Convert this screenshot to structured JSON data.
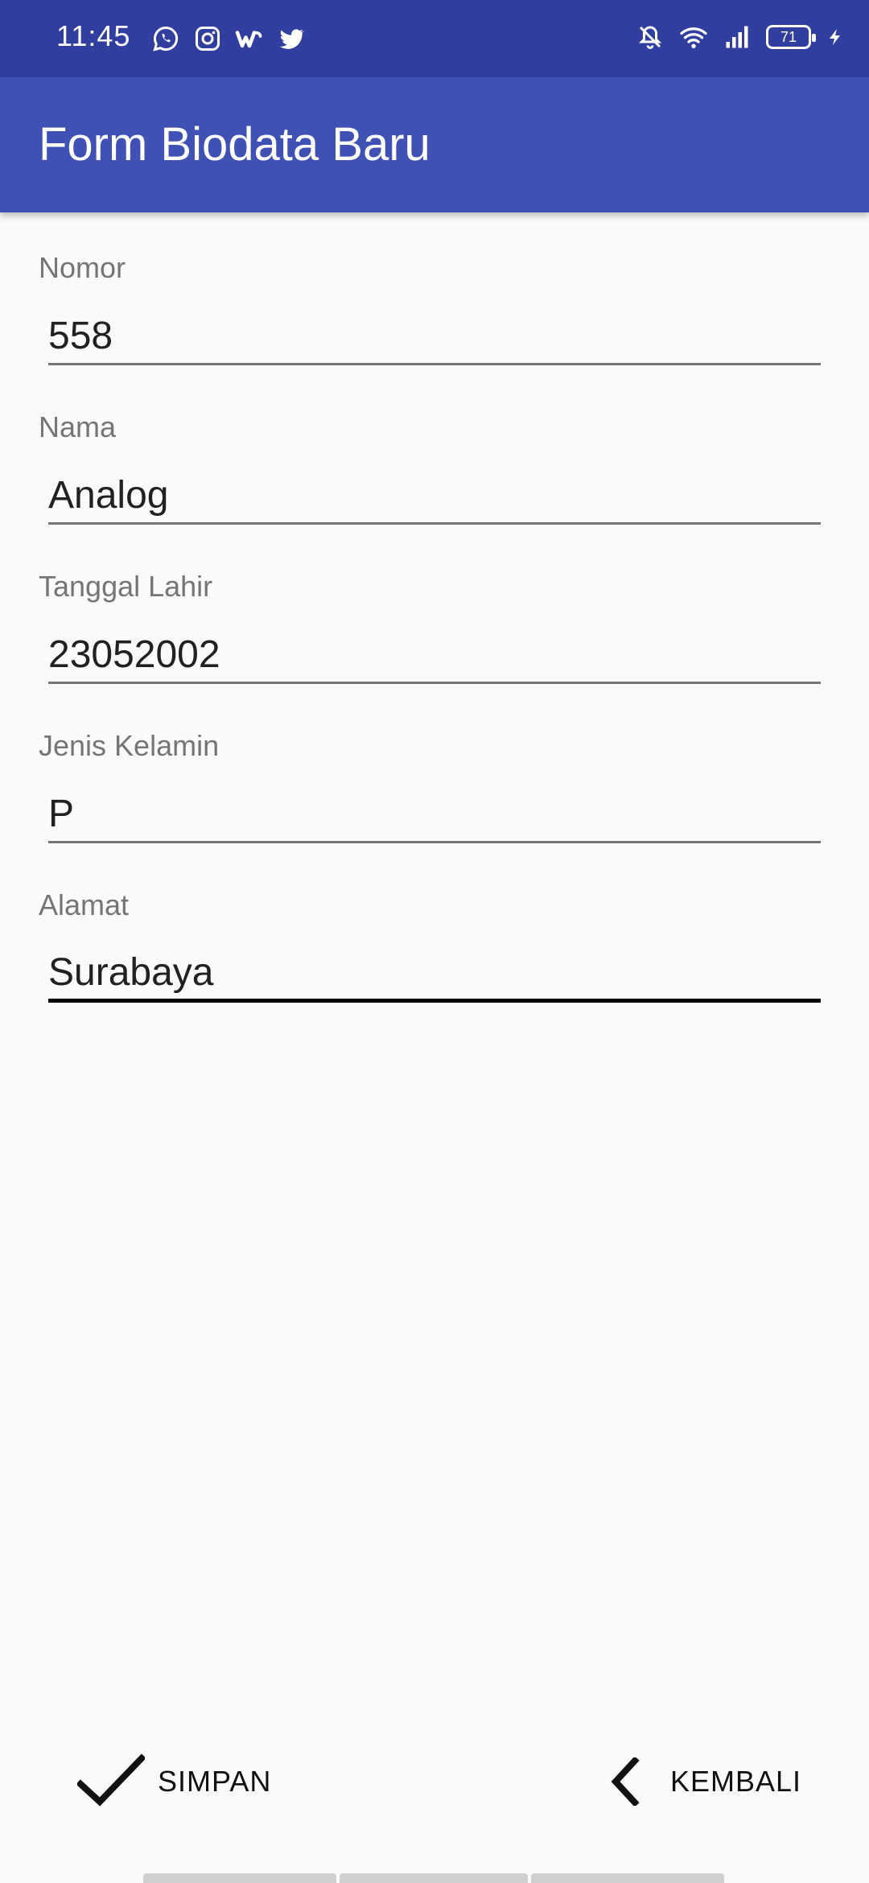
{
  "status_bar": {
    "time": "11:45",
    "left_icons": [
      "whatsapp-icon",
      "instagram-icon",
      "wattpad-icon",
      "twitter-icon"
    ],
    "right_icons": [
      "mute-icon",
      "wifi-icon",
      "signal-icon",
      "battery-icon",
      "charging-icon"
    ],
    "battery": "71"
  },
  "app_bar": {
    "title": "Form Biodata Baru"
  },
  "fields": [
    {
      "label": "Nomor",
      "value": "558"
    },
    {
      "label": "Nama",
      "value": "Analog"
    },
    {
      "label": "Tanggal Lahir",
      "value": "23052002"
    },
    {
      "label": "Jenis Kelamin",
      "value": "P"
    },
    {
      "label": "Alamat",
      "value": "Surabaya"
    }
  ],
  "actions": {
    "save_label": "SIMPAN",
    "save_icon": "check-icon",
    "back_label": "KEMBALI",
    "back_icon": "chevron-left-icon"
  },
  "colors": {
    "status_bar": "#303f9f",
    "app_bar": "#3f51b5",
    "background": "#fafafa",
    "label": "#757575",
    "text": "#212121"
  }
}
